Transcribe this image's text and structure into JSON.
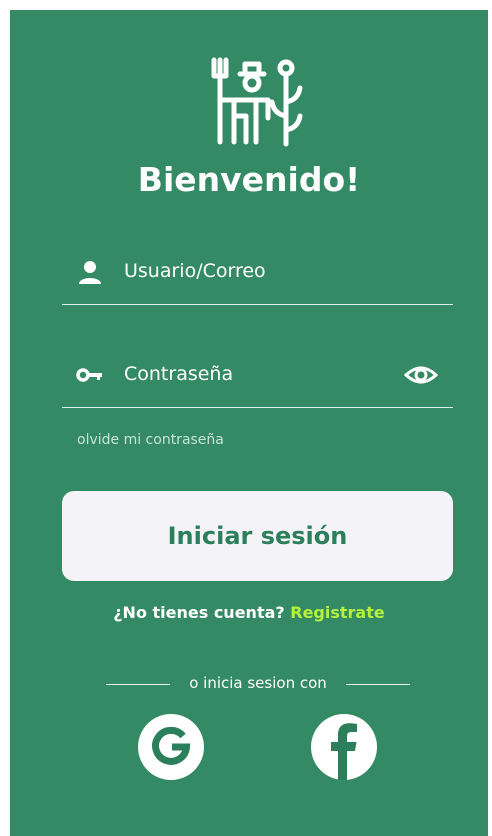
{
  "app": {
    "welcome_title": "Bienvenido!",
    "logo_icon": "farmer-icon"
  },
  "form": {
    "username_placeholder": "Usuario/Correo",
    "username_icon": "user-icon",
    "password_placeholder": "Contraseña",
    "password_icon": "key-icon",
    "password_toggle_icon": "eye-icon",
    "forgot_password": "olvide mi contraseña",
    "login_button": "Iniciar sesión"
  },
  "register": {
    "prompt": "¿No tienes cuenta?",
    "link": "Registrate"
  },
  "social": {
    "divider_text": "o inicia sesion con",
    "google_icon": "google-icon",
    "facebook_icon": "facebook-icon"
  },
  "colors": {
    "background": "#338a64",
    "button_text": "#2b7f5a",
    "link": "#b5f23c",
    "button_bg": "#f4f4f8"
  }
}
